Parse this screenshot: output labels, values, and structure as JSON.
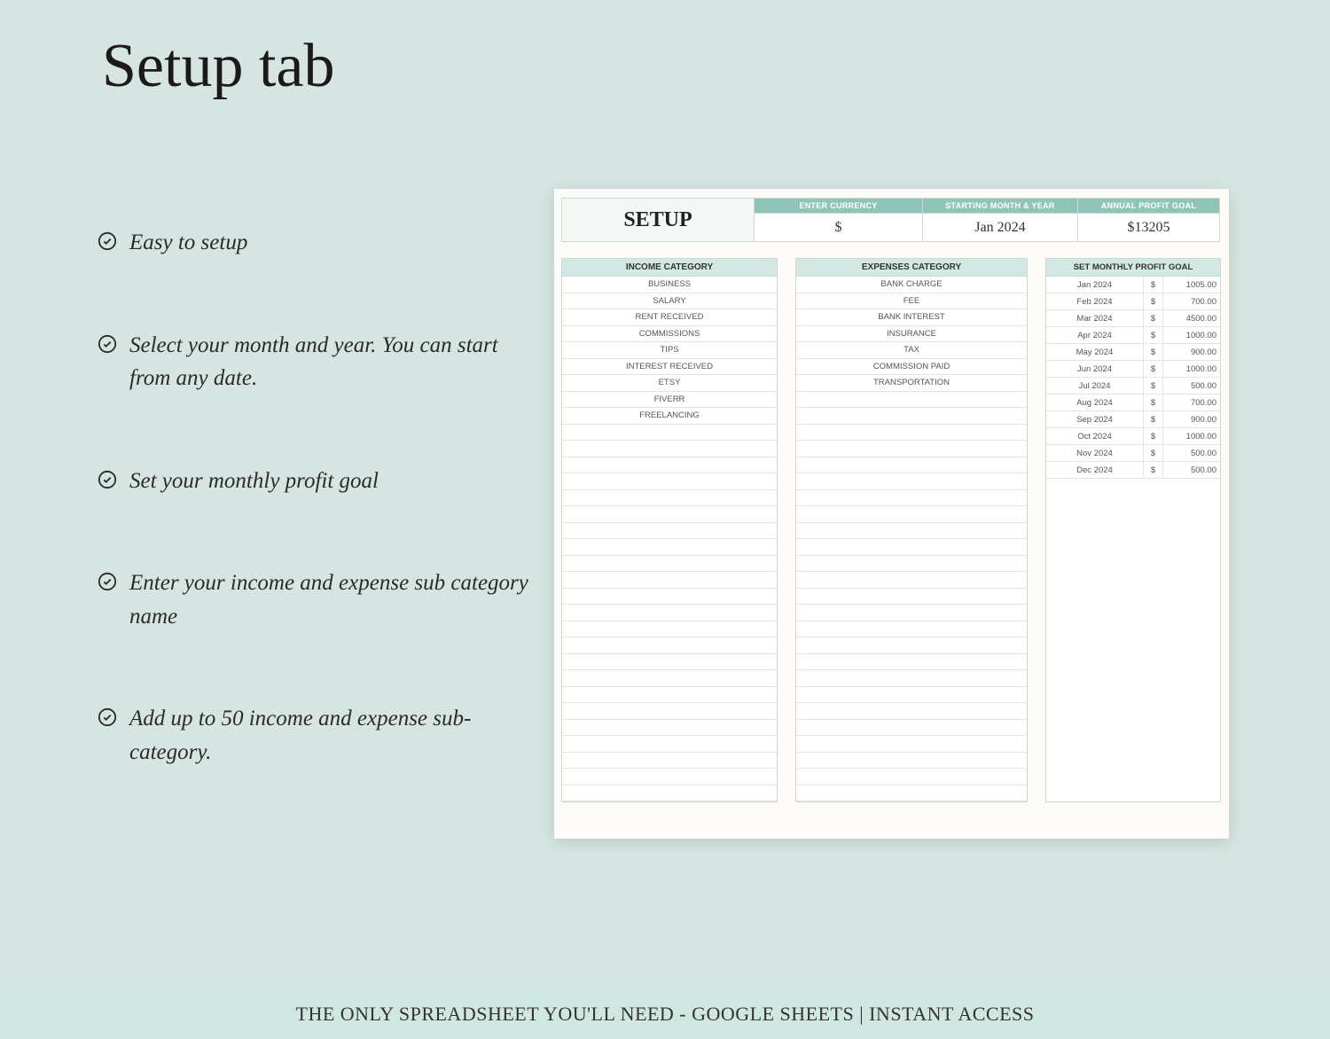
{
  "title": "Setup tab",
  "bullets": [
    "Easy to setup",
    "Select your month and year. You can start from any date.",
    "Set your monthly profit goal",
    "Enter your income and expense sub category name",
    "Add up to 50 income and expense sub-category."
  ],
  "spreadsheet": {
    "setup_label": "SETUP",
    "headers": {
      "currency": "ENTER CURRENCY",
      "starting": "STARTING MONTH & YEAR",
      "annual": "ANNUAL PROFIT GOAL"
    },
    "values": {
      "currency": "$",
      "starting": "Jan 2024",
      "annual": "$13205"
    },
    "income_header": "INCOME CATEGORY",
    "income_categories": [
      "BUSINESS",
      "SALARY",
      "RENT RECEIVED",
      "COMMISSIONS",
      "TIPS",
      "INTEREST RECEIVED",
      "ETSY",
      "FIVERR",
      "FREELANCING"
    ],
    "expense_header": "EXPENSES CATEGORY",
    "expense_categories": [
      "BANK CHARGE",
      "FEE",
      "BANK INTEREST",
      "INSURANCE",
      "TAX",
      "COMMISSION PAID",
      "TRANSPORTATION"
    ],
    "goal_header": "SET MONTHLY PROFIT GOAL",
    "monthly_goals": [
      {
        "month": "Jan 2024",
        "currency": "$",
        "amount": "1005.00"
      },
      {
        "month": "Feb 2024",
        "currency": "$",
        "amount": "700.00"
      },
      {
        "month": "Mar 2024",
        "currency": "$",
        "amount": "4500.00"
      },
      {
        "month": "Apr 2024",
        "currency": "$",
        "amount": "1000.00"
      },
      {
        "month": "May 2024",
        "currency": "$",
        "amount": "900.00"
      },
      {
        "month": "Jun 2024",
        "currency": "$",
        "amount": "1000.00"
      },
      {
        "month": "Jul 2024",
        "currency": "$",
        "amount": "500.00"
      },
      {
        "month": "Aug 2024",
        "currency": "$",
        "amount": "700.00"
      },
      {
        "month": "Sep 2024",
        "currency": "$",
        "amount": "900.00"
      },
      {
        "month": "Oct 2024",
        "currency": "$",
        "amount": "1000.00"
      },
      {
        "month": "Nov 2024",
        "currency": "$",
        "amount": "500.00"
      },
      {
        "month": "Dec 2024",
        "currency": "$",
        "amount": "500.00"
      }
    ],
    "blank_rows_income": 32,
    "blank_rows_expense": 32
  },
  "footer": "THE ONLY SPREADSHEET YOU'LL NEED - GOOGLE SHEETS | INSTANT ACCESS"
}
